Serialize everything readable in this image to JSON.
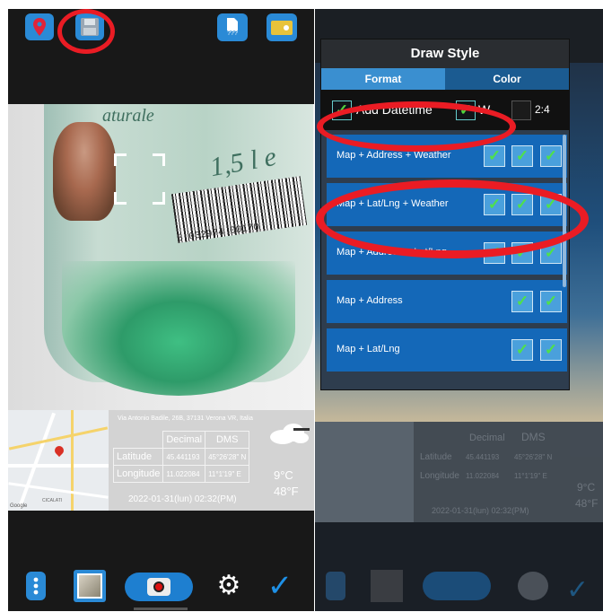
{
  "left": {
    "toolbar": {
      "doc_icon_label": "???"
    },
    "photo": {
      "label_top": "aturale",
      "label_size": "1,5 l e",
      "barcode_num": "8 032974 00170"
    },
    "stamp": {
      "address": "Via Antonio Badile, 26B, 37131 Verona VR, Italia",
      "headers": [
        "",
        "Decimal",
        "DMS"
      ],
      "rows": [
        [
          "Latitude",
          "45.441193",
          "45°26'28\" N"
        ],
        [
          "Longitude",
          "11.022084",
          "11°1'19\" E"
        ]
      ],
      "datetime": "2022-01-31(lun)  02:32(PM)",
      "temp_c": "9°C",
      "temp_f": "48°F",
      "map_label1": "Google",
      "map_label2": "CICALATI"
    }
  },
  "right": {
    "dialog": {
      "title": "Draw Style",
      "tabs": [
        "Format",
        "Color"
      ],
      "option_datetime": "Add Datetime",
      "option_w": "W",
      "option_ratio": "2:4",
      "items": [
        "Map + Address + Weather",
        "Map + Lat/Lng + Weather",
        "Map + Address + Lat/Lng",
        "Map + Address",
        "Map + Lat/Lng"
      ]
    },
    "stamp_faded": {
      "headers": [
        "Decimal",
        "DMS"
      ],
      "rows": [
        [
          "Latitude",
          "45.441193",
          "45°26'28\" N"
        ],
        [
          "Longitude",
          "11.022084",
          "11°1'19\" E"
        ]
      ],
      "datetime": "2022-01-31(lun)  02:32(PM)",
      "temp_c": "9°C",
      "temp_f": "48°F"
    }
  },
  "colors": {
    "accent": "#2a8ad6",
    "highlight_ring": "#ea1c24",
    "check": "#52d43e"
  },
  "icons": [
    "location-pin-icon",
    "save-icon",
    "document-icon",
    "label-icon",
    "menu-icon",
    "gallery-icon",
    "camera-icon",
    "gear-icon",
    "check-icon"
  ]
}
